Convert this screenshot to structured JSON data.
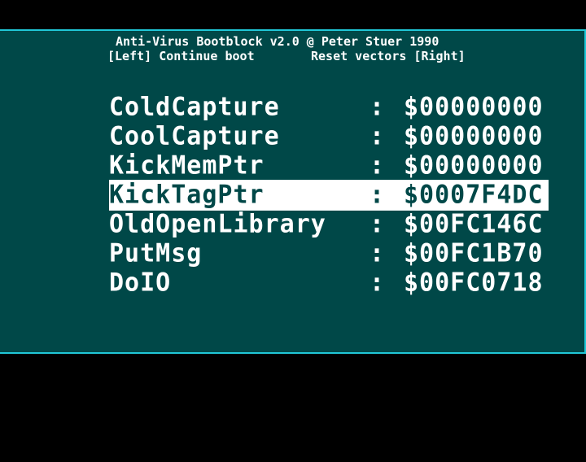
{
  "header": {
    "title": "Anti-Virus Bootblock v2.0 @ Peter Stuer 1990",
    "left_hint": "[Left] Continue boot",
    "right_hint": "Reset vectors [Right]"
  },
  "colors": {
    "background": "#000000",
    "panel": "#004848",
    "border": "#20c8d8",
    "text": "#ffffff",
    "highlight": "#ffffff"
  },
  "vectors": [
    {
      "name": "ColdCapture",
      "separator": ":",
      "value": "$00000000",
      "selected": false
    },
    {
      "name": "CoolCapture",
      "separator": ":",
      "value": "$00000000",
      "selected": false
    },
    {
      "name": "KickMemPtr",
      "separator": ":",
      "value": "$00000000",
      "selected": false
    },
    {
      "name": "KickTagPtr",
      "separator": ":",
      "value": "$0007F4DC",
      "selected": true
    },
    {
      "name": "OldOpenLibrary",
      "separator": ":",
      "value": "$00FC146C",
      "selected": false
    },
    {
      "name": "PutMsg",
      "separator": ":",
      "value": "$00FC1B70",
      "selected": false
    },
    {
      "name": "DoIO",
      "separator": ":",
      "value": "$00FC0718",
      "selected": false
    }
  ]
}
